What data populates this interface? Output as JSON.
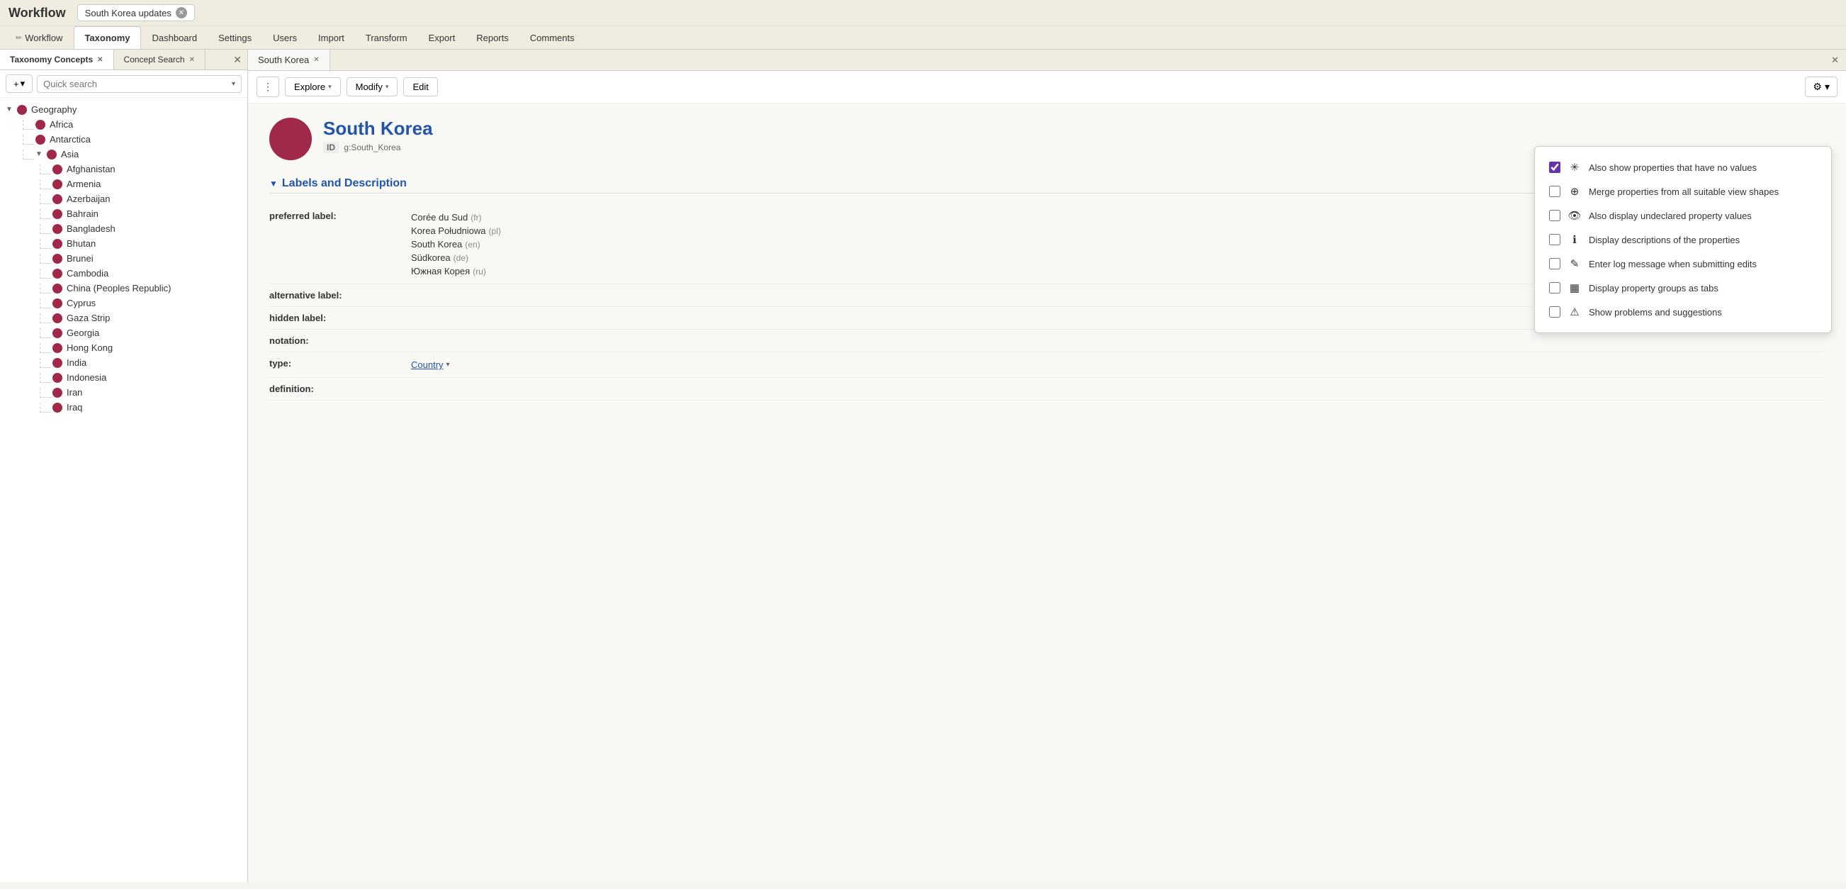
{
  "titleBar": {
    "appTitle": "Workflow",
    "windowTab": {
      "label": "South Korea updates",
      "closeIcon": "✕"
    }
  },
  "navBar": {
    "items": [
      {
        "id": "workflow",
        "label": "Workflow",
        "icon": "✏️",
        "active": false
      },
      {
        "id": "taxonomy",
        "label": "Taxonomy",
        "active": true
      },
      {
        "id": "dashboard",
        "label": "Dashboard",
        "active": false
      },
      {
        "id": "settings",
        "label": "Settings",
        "active": false
      },
      {
        "id": "users",
        "label": "Users",
        "active": false
      },
      {
        "id": "import",
        "label": "Import",
        "active": false
      },
      {
        "id": "transform",
        "label": "Transform",
        "active": false
      },
      {
        "id": "export",
        "label": "Export",
        "active": false
      },
      {
        "id": "reports",
        "label": "Reports",
        "active": false
      },
      {
        "id": "comments",
        "label": "Comments",
        "active": false
      }
    ]
  },
  "leftPanel": {
    "tabs": [
      {
        "id": "taxonomy-concepts",
        "label": "Taxonomy Concepts",
        "active": true
      },
      {
        "id": "concept-search",
        "label": "Concept Search",
        "active": false
      }
    ],
    "addButton": "+",
    "addDropdown": "▾",
    "searchPlaceholder": "Quick search",
    "searchDropdown": "▾",
    "tree": {
      "root": {
        "label": "Geography",
        "expanded": true,
        "children": [
          {
            "label": "Africa",
            "children": []
          },
          {
            "label": "Antarctica",
            "children": []
          },
          {
            "label": "Asia",
            "expanded": true,
            "children": [
              {
                "label": "Afghanistan"
              },
              {
                "label": "Armenia"
              },
              {
                "label": "Azerbaijan"
              },
              {
                "label": "Bahrain"
              },
              {
                "label": "Bangladesh"
              },
              {
                "label": "Bhutan"
              },
              {
                "label": "Brunei"
              },
              {
                "label": "Cambodia"
              },
              {
                "label": "China (Peoples Republic)"
              },
              {
                "label": "Cyprus"
              },
              {
                "label": "Gaza Strip"
              },
              {
                "label": "Georgia"
              },
              {
                "label": "Hong Kong"
              },
              {
                "label": "India"
              },
              {
                "label": "Indonesia"
              },
              {
                "label": "Iran"
              },
              {
                "label": "Iraq"
              }
            ]
          }
        ]
      }
    }
  },
  "rightPanel": {
    "tab": {
      "label": "South Korea",
      "closeIcon": "✕"
    },
    "toolbar": {
      "dotsLabel": "⋮",
      "exploreLabel": "Explore",
      "modifyLabel": "Modify",
      "editLabel": "Edit",
      "dropdownArrow": "▾",
      "gearIcon": "⚙",
      "gearDropdown": "▾"
    },
    "concept": {
      "title": "South Korea",
      "idLabel": "ID",
      "idValue": "g:South_Korea"
    },
    "sections": [
      {
        "id": "labels-description",
        "title": "Labels and Description",
        "toggleIcon": "▼",
        "properties": [
          {
            "label": "preferred label:",
            "values": [
              {
                "text": "Corée du Sud",
                "lang": "(fr)"
              },
              {
                "text": "Korea Południowa",
                "lang": "(pl)"
              },
              {
                "text": "South Korea",
                "lang": "(en)"
              },
              {
                "text": "Südkorea",
                "lang": "(de)"
              },
              {
                "text": "Южная Корея",
                "lang": "(ru)"
              }
            ]
          },
          {
            "label": "alternative label:",
            "values": []
          },
          {
            "label": "hidden label:",
            "values": []
          },
          {
            "label": "notation:",
            "values": []
          },
          {
            "label": "type:",
            "values": [
              {
                "text": "Country",
                "link": true,
                "dropdown": "▾"
              }
            ]
          },
          {
            "label": "definition:",
            "values": []
          }
        ]
      }
    ],
    "settingsDropdown": {
      "options": [
        {
          "id": "show-no-values",
          "label": "Also show properties that have no values",
          "icon": "✳",
          "checked": true
        },
        {
          "id": "merge-properties",
          "label": "Merge properties from all suitable view shapes",
          "icon": "⊕",
          "checked": false
        },
        {
          "id": "undeclared-values",
          "label": "Also display undeclared property values",
          "icon": "👁",
          "checked": false
        },
        {
          "id": "descriptions",
          "label": "Display descriptions of the properties",
          "icon": "ℹ",
          "checked": false
        },
        {
          "id": "log-message",
          "label": "Enter log message when submitting edits",
          "icon": "✎",
          "checked": false
        },
        {
          "id": "property-groups",
          "label": "Display property groups as tabs",
          "icon": "▦",
          "checked": false
        },
        {
          "id": "problems",
          "label": "Show problems and suggestions",
          "icon": "⚠",
          "checked": false
        }
      ]
    }
  }
}
